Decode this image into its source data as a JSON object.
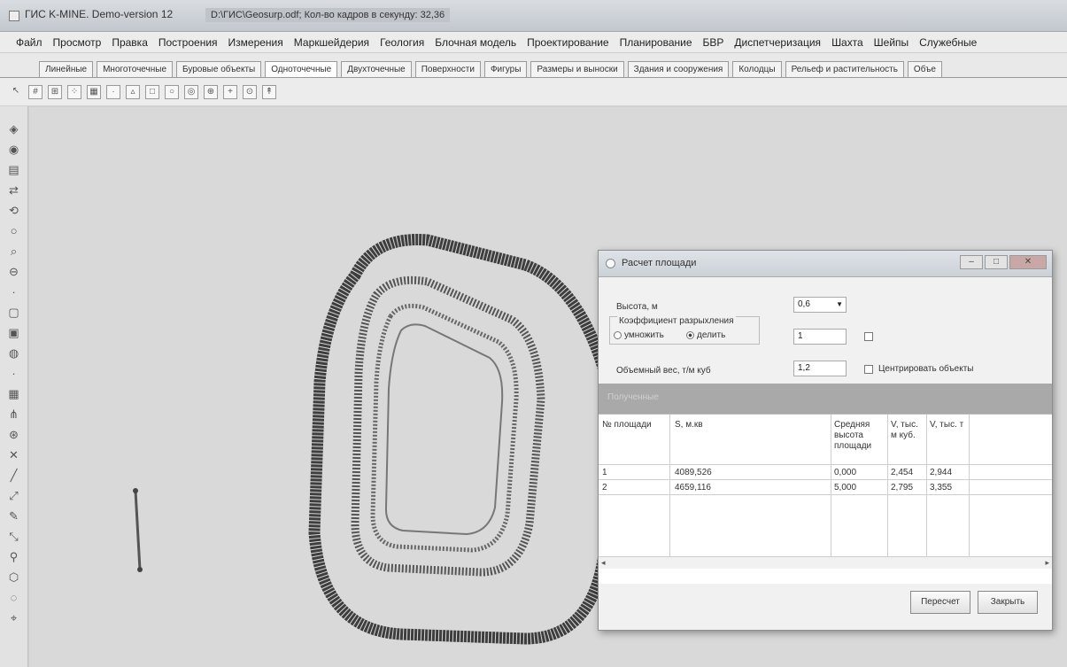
{
  "window": {
    "title": "ГИС K-MINE. Demo-version 12",
    "file": "D:\\ГИС\\Geosurp.odf; Кол-во кадров в секунду: 32,36"
  },
  "menu": [
    "Файл",
    "Просмотр",
    "Правка",
    "Построения",
    "Измерения",
    "Маркшейдерия",
    "Геология",
    "Блочная модель",
    "Проектирование",
    "Планирование",
    "БВР",
    "Диспетчеризация",
    "Шахта",
    "Шейпы",
    "Служебные"
  ],
  "tabs": [
    "Линейные",
    "Многоточечные",
    "Буровые объекты",
    "Одноточечные",
    "Двухточечные",
    "Поверхности",
    "Фигуры",
    "Размеры и выноски",
    "Здания и сооружения",
    "Колодцы",
    "Рельеф и растительность",
    "Объе"
  ],
  "dialog": {
    "title": "Расчет площади",
    "height_label": "Высота, м",
    "height_value": "0,6",
    "coef_label": "Коэффициент разрыхления",
    "multiply_label": "умножить",
    "divide_label": "делить",
    "coef_value": "1",
    "weight_label": "Объемный вес, т/м куб",
    "weight_value": "1,2",
    "center_label": "Центрировать объекты",
    "section_label": "Полученные",
    "columns": [
      "№ площади",
      "S, м.кв",
      "Средняя высота площади",
      "V, тыс. м куб.",
      "V, тыс. т"
    ],
    "rows": [
      {
        "n": "1",
        "s": "4089,526",
        "h": "0,000",
        "v": "2,454",
        "t": "2,944"
      },
      {
        "n": "2",
        "s": "4659,116",
        "h": "5,000",
        "v": "2,795",
        "t": "3,355"
      }
    ],
    "recalc_label": "Пересчет",
    "close_label": "Закрыть"
  }
}
